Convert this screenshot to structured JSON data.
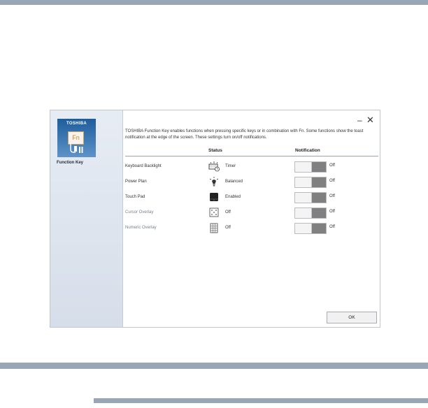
{
  "app": {
    "brand": "TOSHIBA",
    "tile_glyph": "Fn",
    "name": "Function Key",
    "colors": {
      "tile_top": "#1d5d9c",
      "tile_bottom": "#5e93c8",
      "toggle_track": "#808080",
      "rule": "#98a6b5"
    }
  },
  "window": {
    "minimize_label": "–",
    "close_label": "✕",
    "description": "TOSHIBA Function Key enables functions when pressing specific keys or in combination with Fn. Some functions show the toast notification at the edge of the screen. These settings turn on/off notifications."
  },
  "columns": {
    "status": "Status",
    "notification": "Notification"
  },
  "rows": [
    {
      "label": "Keyboard Backlight",
      "status": "Timer",
      "icon": "keyboard-backlight-icon",
      "notification": "Off",
      "enabled": true
    },
    {
      "label": "Power Plan",
      "status": "Balanced",
      "icon": "power-plan-bulb-icon",
      "notification": "Off",
      "enabled": true
    },
    {
      "label": "Touch Pad",
      "status": "Enabled",
      "icon": "touchpad-icon",
      "notification": "Off",
      "enabled": true
    },
    {
      "label": "Cursor Overlay",
      "status": "Off",
      "icon": "cursor-overlay-icon",
      "notification": "Off",
      "enabled": false
    },
    {
      "label": "Numeric Overlay",
      "status": "Off",
      "icon": "numeric-overlay-icon",
      "notification": "Off",
      "enabled": false
    }
  ],
  "footer": {
    "ok_label": "OK"
  }
}
